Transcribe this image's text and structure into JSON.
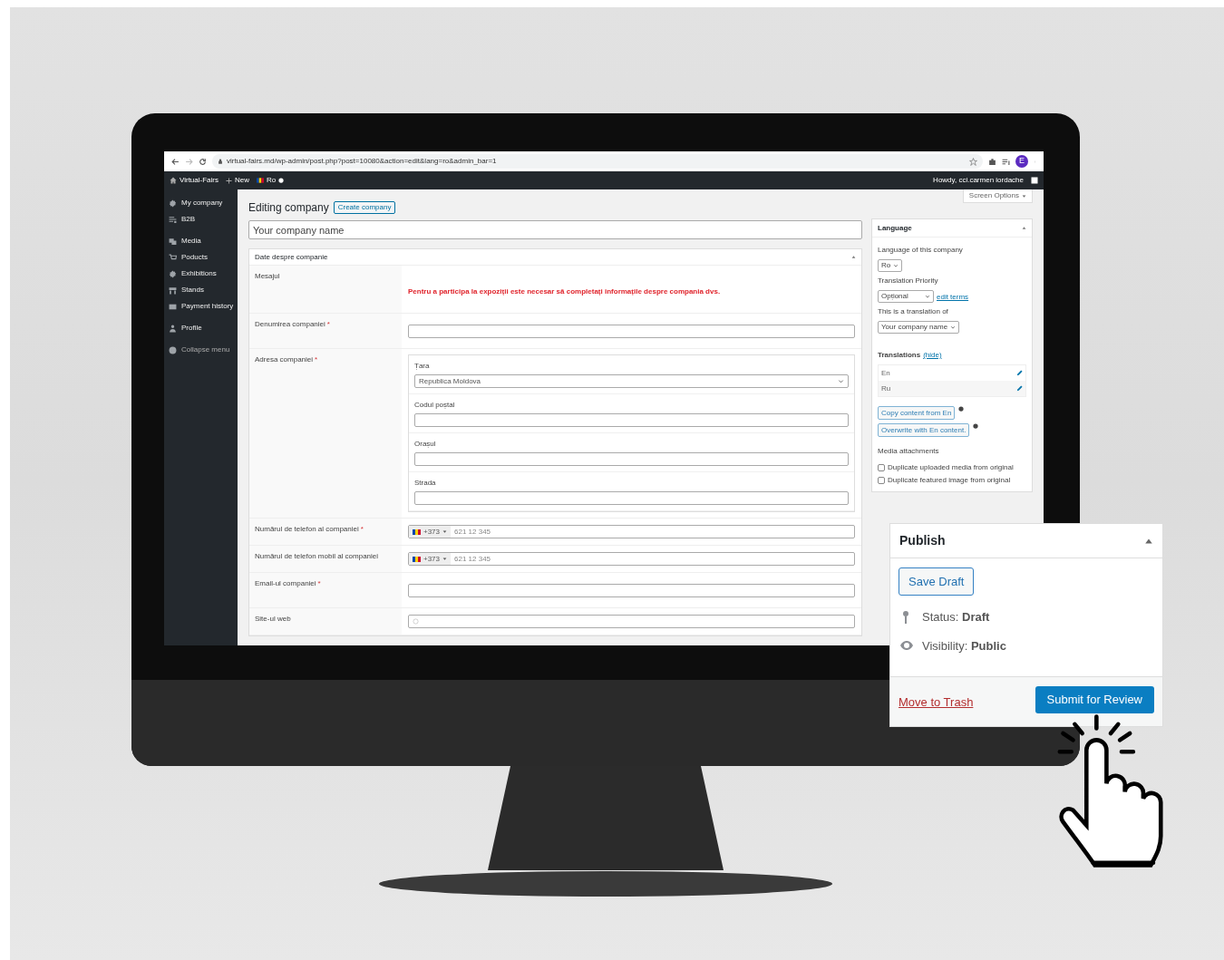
{
  "browser": {
    "url": "virtual-fairs.md/wp-admin/post.php?post=10080&action=edit&lang=ro&admin_bar=1",
    "avatar": "E"
  },
  "admin_bar": {
    "site": "Virtual-Fairs",
    "new": "New",
    "language": "Ro",
    "greeting": "Howdy, cci.carmen iordache"
  },
  "sidebar": {
    "items": [
      {
        "label": "My company"
      },
      {
        "label": "B2B"
      },
      {
        "label": "Media"
      },
      {
        "label": "Poducts"
      },
      {
        "label": "Exhibitions"
      },
      {
        "label": "Stands"
      },
      {
        "label": "Payment history"
      },
      {
        "label": "Profile"
      }
    ],
    "collapse": "Collapse menu"
  },
  "screen_options": "Screen Options",
  "page": {
    "title": "Editing company",
    "create_button": "Create company",
    "name_placeholder": "Your company name"
  },
  "company_box": {
    "title": "Date despre companie",
    "rows": [
      {
        "kind": "message",
        "label": "Mesajul",
        "message": "Pentru a participa la expoziții este necesar să completați informațile despre compania dvs."
      },
      {
        "kind": "text",
        "label": "Denumirea companiei",
        "required_mark": "*"
      },
      {
        "kind": "address",
        "label": "Adresa companiei",
        "required_mark": "*",
        "fields": [
          {
            "kind": "select",
            "label": "Țara",
            "value": "Republica Moldova"
          },
          {
            "kind": "text",
            "label": "Codul poștal"
          },
          {
            "kind": "text",
            "label": "Orașul"
          },
          {
            "kind": "text",
            "label": "Strada"
          }
        ]
      },
      {
        "kind": "phone",
        "label": "Numărul de telefon al companiei",
        "required_mark": "*",
        "code": "+373",
        "placeholder": "621 12 345"
      },
      {
        "kind": "phone",
        "label": "Numărul de telefon mobil al companiei",
        "code": "+373",
        "placeholder": "621 12 345"
      },
      {
        "kind": "text",
        "label": "Email-ul companiei",
        "required_mark": "*"
      },
      {
        "kind": "url",
        "label": "Site-ul web"
      }
    ]
  },
  "language_box": {
    "title": "Language",
    "language_label": "Language of this company",
    "language": "Ro",
    "priority_label": "Translation Priority",
    "priority": "Opțional",
    "edit_terms": "edit terms",
    "translation_of_label": "This is a translation of",
    "translation_of": "Your company name",
    "translations_label": "Translations",
    "hide": "(hide)",
    "translations": [
      {
        "language": "En"
      },
      {
        "language": "Ru"
      }
    ],
    "copy_button": "Copy content from En",
    "overwrite_button": "Overwrite with En content.",
    "media_label": "Media attachments",
    "media_options": [
      {
        "label": "Duplicate uploaded media from original",
        "checked": false
      },
      {
        "label": "Duplicate featured image from original",
        "checked": false
      }
    ]
  },
  "publish": {
    "title": "Publish",
    "save_draft": "Save Draft",
    "status": "Status: **Draft**",
    "visibility": "Visibility: **Public**",
    "trash": "Move to Trash",
    "submit": "Submit for Review"
  }
}
